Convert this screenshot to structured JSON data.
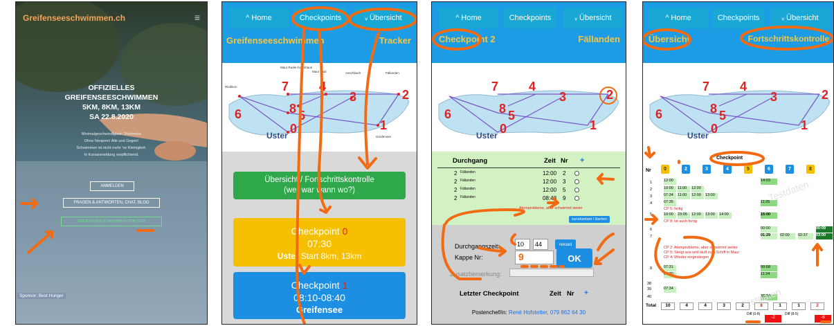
{
  "p1": {
    "site_title": "Greifenseeschwimmen.ch",
    "h1": "OFFIZIELLES",
    "h2": "GREIFENSEESCHWIMMEN",
    "h3": "5KM, 8KM, 13KM",
    "h4": "SA 22.8.2020",
    "desc1": "Minimalgeschwindigkeit: 2h/strecke",
    "desc2": "Ohne Neopren! Alle und Gegen!",
    "desc3": "Schwimmen ist nicht mehr 'ne Kleinigkeit.",
    "desc4": "In Kursanmeldung verpflichtend.",
    "btn_login": "ANMELDEN",
    "btn_faq": "FRAGEN & ANTWORTEN, CHAT, BLOG",
    "btn_tracker": "GREIFENSEESCHWIMMEN-TRACKER",
    "sponsor": "Sponsor: Best Hunger"
  },
  "nav": {
    "home": "^ Home",
    "checkpoints": "Checkpoints",
    "overview": "ᵥ Übersicht"
  },
  "p2": {
    "title_left": "Greifenseeschwimmen",
    "title_right": "Tracker",
    "overview_btn_l1": "Übersicht / Fortschrittskontrolle",
    "overview_btn_l2": "(wer war wann wo?)",
    "cp0_title": "Checkpoint",
    "cp0_num": "0",
    "cp0_time": "07:30",
    "cp0_place": "Uster",
    "cp0_desc": "Start 8km, 13km",
    "cp1_title": "Checkpoint",
    "cp1_num": "1",
    "cp1_time": "08:10-08:40",
    "cp1_place": "Greifensee"
  },
  "map": {
    "n7": "7",
    "n4": "4",
    "n3": "3",
    "n2": "2",
    "n8": "8",
    "n5": "5",
    "n6": "6",
    "n0": "0",
    "n1": "1",
    "uster": "Uster",
    "lab_ruder": "Maur Ruder-bootshaus",
    "lab_badi": "Maur Badi",
    "lab_aesch": "Aeschbach",
    "lab_faell": "Fällanden",
    "lab_riedikon": "Riedikon",
    "lab_greif": "Greifensee"
  },
  "p3": {
    "title_left": "Checkpoint 2",
    "title_right": "Fällanden",
    "col_durchgang": "Durchgang",
    "col_zeit": "Zeit",
    "col_nr": "Nr",
    "plus": "+",
    "rows": [
      {
        "n": "2",
        "loc": "Fällanden",
        "zeit": "12:00",
        "nr": "2"
      },
      {
        "n": "2",
        "loc": "Fällanden",
        "zeit": "12:00",
        "nr": "3"
      },
      {
        "n": "2",
        "loc": "Fällanden",
        "zeit": "12:00",
        "nr": "5"
      },
      {
        "n": "2",
        "loc": "Fällanden",
        "zeit": "08:43",
        "nr": "9"
      }
    ],
    "note": "Atemprobleme, aber schwimmt weiter",
    "reset_btn": "zurücksetzen / löschen",
    "lbl_time": "Durchgangszeit:",
    "time_h": "10",
    "time_m": "44",
    "reload": "reload",
    "lbl_kappe": "Kappe Nr:",
    "kappe_val": "9",
    "ok": "OK",
    "lbl_zusatz": "Zusatzbemerkung:",
    "last_cp": "Letzter Checkpoint",
    "last_zeit": "Zeit",
    "last_nr": "Nr",
    "postenchef_lbl": "Postenchef/in:",
    "postenchef": "René Hofstetter, 079 862 64 30"
  },
  "p4": {
    "title_left": "Übersicht",
    "title_right": "Fortschrittskontrolle",
    "checkpoint_lbl": "Checkpoint",
    "nr": "Nr",
    "cps": [
      "0",
      "2",
      "3",
      "4",
      "5",
      "6",
      "7",
      "8"
    ],
    "total": "Total",
    "totals": [
      "10",
      "4",
      "4",
      "3",
      "2",
      "8",
      "1",
      "1",
      "2"
    ],
    "diff1": "Diff (0-8)",
    "diff1_val": "-2",
    "diff2": "Diff (8-5)",
    "diff2_val": "-6",
    "watermark": "Testdaten",
    "r1": "1",
    "r2": "2",
    "r3": "3",
    "r4": "4",
    "r5": "5",
    "r6": "6",
    "r7": "7",
    "r8": "8",
    "r38": "38",
    "r39": "39",
    "r40": "40",
    "t1200": "12:00",
    "t1403": "14:03",
    "t1000": "10:00",
    "t1100": "11:00",
    "t0734": "07:34",
    "t1300": "13:00",
    "t0735": "07:35",
    "t1125": "11:25",
    "cp5fertig": "CP 5: fertig",
    "cp8fertig": "CP 8: ist auch fertig",
    "t2305": "23:05",
    "t1400": "14:00",
    "t1500": "15:00",
    "t0000": "00:00",
    "t0009": "00:09",
    "t0129": "01:29",
    "t0200": "02:00",
    "t0237": "02:37",
    "t0300": "03:00",
    "note1": "CP 2: Atemprobleme, aber schwimmt weiter",
    "note2": "CP 5: Steigt aus und läuft zum Schiff in Maur",
    "note3": "CP 4: Wieder eingestiegen",
    "t0731": "07:31",
    "t0958": "09:58",
    "t0730": "07:30",
    "t1124": "11:24",
    "t1024": "10:24"
  }
}
